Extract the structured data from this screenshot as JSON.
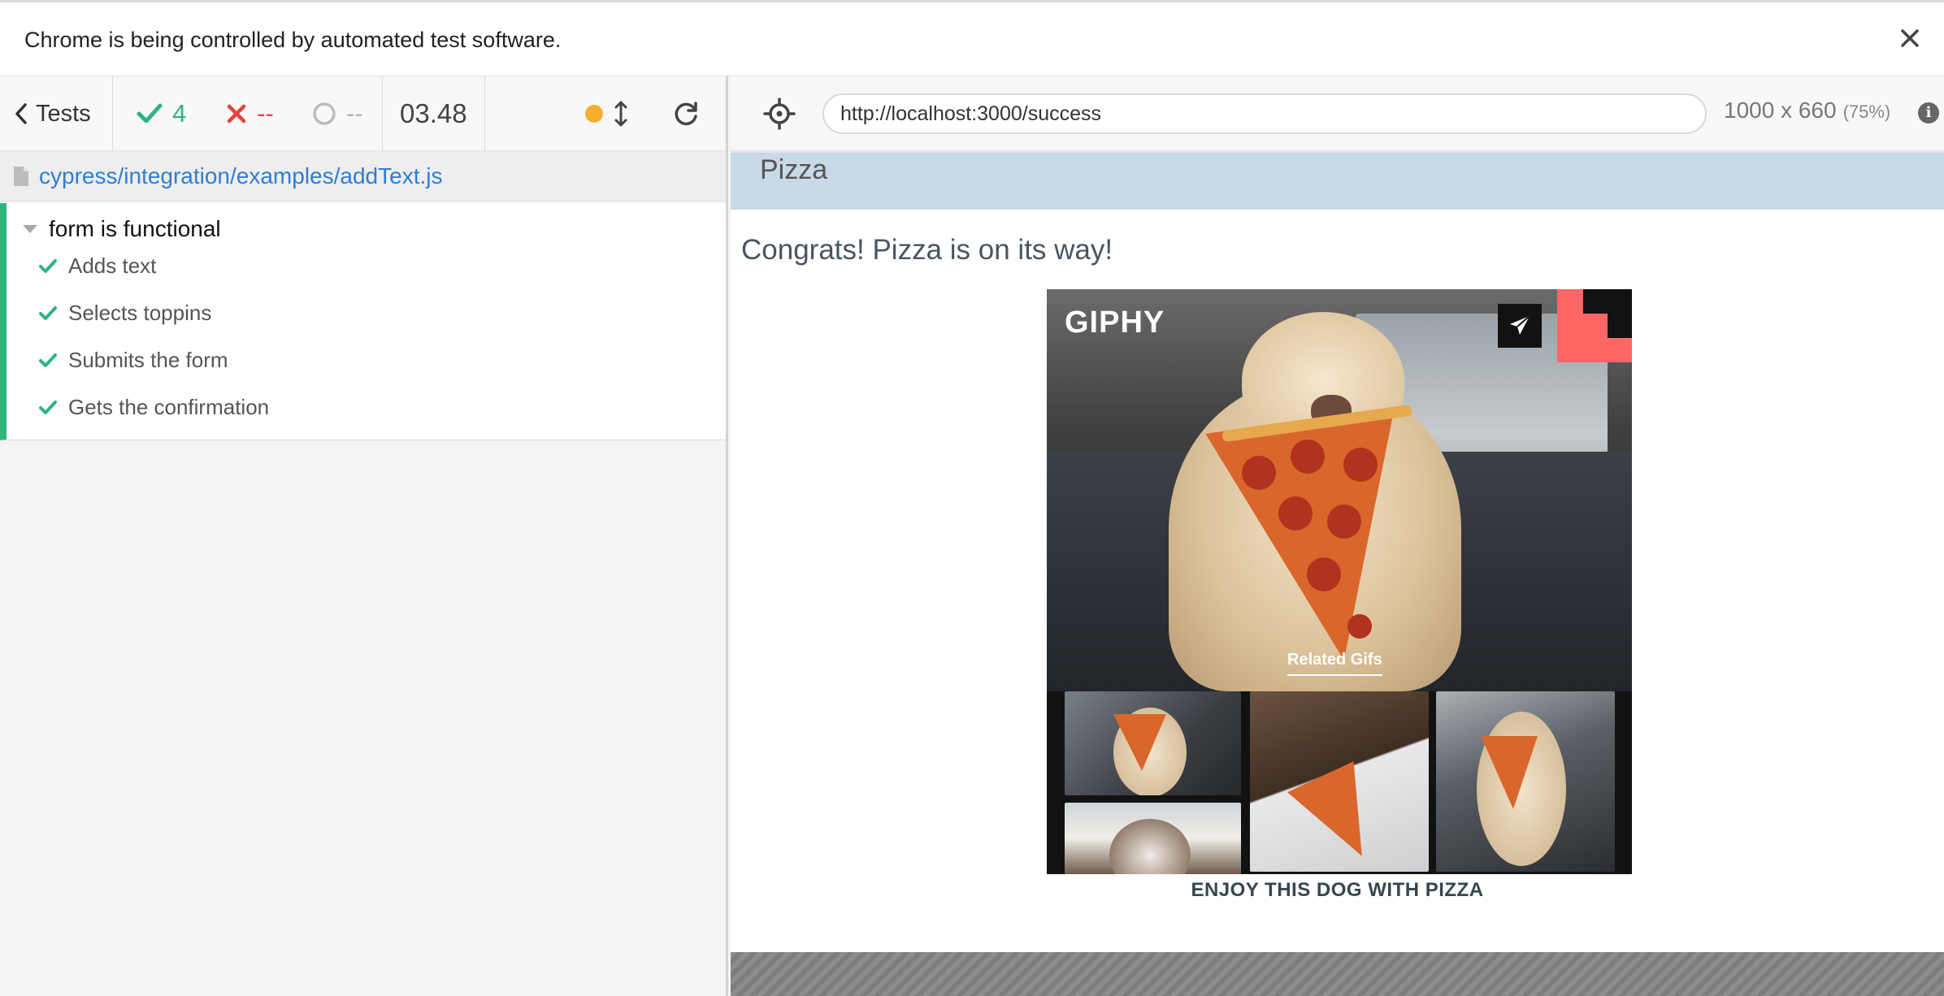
{
  "infobar": {
    "message": "Chrome is being controlled by automated test software."
  },
  "reporter": {
    "tests_label": "Tests",
    "passed": "4",
    "failed": "--",
    "pending": "--",
    "duration": "03.48",
    "spec_path": "cypress/integration/examples/addText.js",
    "suite": {
      "title": "form is functional",
      "tests": [
        {
          "title": "Adds text",
          "state": "passed"
        },
        {
          "title": "Selects toppins",
          "state": "passed"
        },
        {
          "title": "Submits the form",
          "state": "passed"
        },
        {
          "title": "Gets the confirmation",
          "state": "passed"
        }
      ]
    }
  },
  "aut": {
    "url": "http://localhost:3000/success",
    "viewport_size": "1000 x 660",
    "viewport_scale": "(75%)",
    "app": {
      "brand": "Pizza",
      "message": "Congrats! Pizza is on its way!",
      "giphy_logo": "GIPHY",
      "related_label": "Related Gifs",
      "caption": "ENJOY THIS DOG WITH PIZZA"
    }
  },
  "colors": {
    "pass": "#2fb47e",
    "fail": "#e2453c",
    "running_dot": "#f6ae2d",
    "link": "#2f7dd7",
    "nav_bg": "#c9d9e8"
  },
  "icons": [
    "close-icon",
    "chevron-left-icon",
    "check-icon",
    "x-icon",
    "circle-icon",
    "resize-icon",
    "reload-icon",
    "file-icon",
    "caret-down-icon",
    "crosshair-icon",
    "info-icon",
    "share-icon"
  ]
}
